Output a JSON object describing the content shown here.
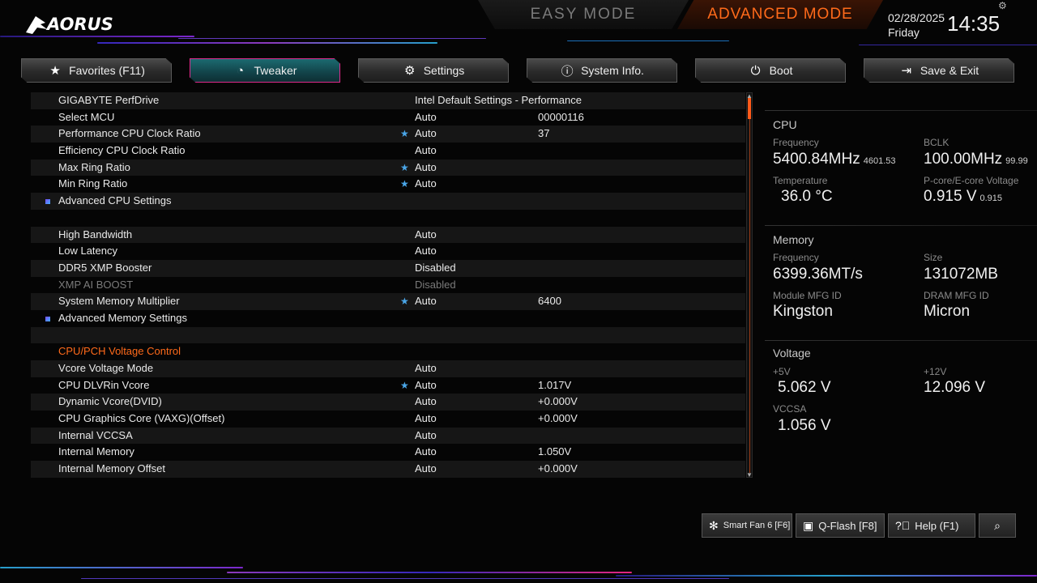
{
  "header": {
    "brand": "AORUS",
    "easy_mode": "EASY MODE",
    "advanced_mode": "ADVANCED MODE",
    "date": "02/28/2025",
    "day": "Friday",
    "time": "14:35"
  },
  "tabs": [
    {
      "label": "Favorites (F11)",
      "icon": "star-icon",
      "active": false
    },
    {
      "label": "Tweaker",
      "icon": "speedometer-icon",
      "active": true
    },
    {
      "label": "Settings",
      "icon": "gear-icon",
      "active": false
    },
    {
      "label": "System Info.",
      "icon": "info-icon",
      "active": false
    },
    {
      "label": "Boot",
      "icon": "power-icon",
      "active": false
    },
    {
      "label": "Save & Exit",
      "icon": "exit-icon",
      "active": false
    }
  ],
  "settings": [
    {
      "name": "GIGABYTE PerfDrive",
      "value": "Intel Default Settings - Performance",
      "value2": "",
      "star": false
    },
    {
      "name": "Select MCU",
      "value": "Auto",
      "value2": "00000116",
      "star": false
    },
    {
      "name": "Performance CPU Clock Ratio",
      "value": "Auto",
      "value2": "37",
      "star": true
    },
    {
      "name": "Efficiency CPU Clock Ratio",
      "value": "Auto",
      "value2": "",
      "star": false
    },
    {
      "name": "Max Ring Ratio",
      "value": "Auto",
      "value2": "",
      "star": true
    },
    {
      "name": "Min Ring Ratio",
      "value": "Auto",
      "value2": "",
      "star": true
    },
    {
      "name": "Advanced CPU Settings",
      "value": "",
      "value2": "",
      "star": false,
      "submenu": true
    },
    {
      "name": "",
      "value": "",
      "value2": "",
      "star": false
    },
    {
      "name": "High Bandwidth",
      "value": "Auto",
      "value2": "",
      "star": false
    },
    {
      "name": "Low Latency",
      "value": "Auto",
      "value2": "",
      "star": false
    },
    {
      "name": "DDR5 XMP Booster",
      "value": "Disabled",
      "value2": "",
      "star": false
    },
    {
      "name": "XMP AI BOOST",
      "value": "Disabled",
      "value2": "",
      "star": false,
      "disabled": true
    },
    {
      "name": "System Memory Multiplier",
      "value": "Auto",
      "value2": "6400",
      "star": true
    },
    {
      "name": "Advanced Memory Settings",
      "value": "",
      "value2": "",
      "star": false,
      "submenu": true
    },
    {
      "name": "",
      "value": "",
      "value2": "",
      "star": false
    },
    {
      "name": "CPU/PCH Voltage Control",
      "value": "",
      "value2": "",
      "star": false,
      "section": true
    },
    {
      "name": "Vcore Voltage Mode",
      "value": "Auto",
      "value2": "",
      "star": false
    },
    {
      "name": "CPU DLVRin Vcore",
      "value": "Auto",
      "value2": "1.017V",
      "star": true
    },
    {
      "name": "Dynamic Vcore(DVID)",
      "value": "Auto",
      "value2": "+0.000V",
      "star": false
    },
    {
      "name": "CPU Graphics Core (VAXG)(Offset)",
      "value": "Auto",
      "value2": "+0.000V",
      "star": false
    },
    {
      "name": "Internal VCCSA",
      "value": "Auto",
      "value2": "",
      "star": false
    },
    {
      "name": "Internal Memory",
      "value": "Auto",
      "value2": "1.050V",
      "star": false
    },
    {
      "name": "Internal Memory Offset",
      "value": "Auto",
      "value2": "+0.000V",
      "star": false
    }
  ],
  "info": {
    "cpu": {
      "title": "CPU",
      "freq_label": "Frequency",
      "freq": "5400.84MHz",
      "freq_sub": "4601.53",
      "bclk_label": "BCLK",
      "bclk": "100.00MHz",
      "bclk_sub": "99.99",
      "temp_label": "Temperature",
      "temp": "36.0 °C",
      "volt_label": "P-core/E-core Voltage",
      "volt": "0.915 V",
      "volt_sub": "0.915"
    },
    "memory": {
      "title": "Memory",
      "freq_label": "Frequency",
      "freq": "6399.36MT/s",
      "size_label": "Size",
      "size": "131072MB",
      "module_label": "Module MFG ID",
      "module": "Kingston",
      "dram_label": "DRAM MFG ID",
      "dram": "Micron"
    },
    "voltage": {
      "title": "Voltage",
      "v5_label": "+5V",
      "v5": "5.062 V",
      "v12_label": "+12V",
      "v12": "12.096 V",
      "vccsa_label": "VCCSA",
      "vccsa": "1.056 V"
    }
  },
  "bottom": {
    "smartfan": "Smart Fan 6 [F6]",
    "qflash": "Q-Flash [F8]",
    "help": "Help (F1)"
  },
  "colors": {
    "accent": "#ff6a1a",
    "active_tab": "#124349",
    "active_border": "#e02a8c",
    "star": "#4aa6e8"
  }
}
